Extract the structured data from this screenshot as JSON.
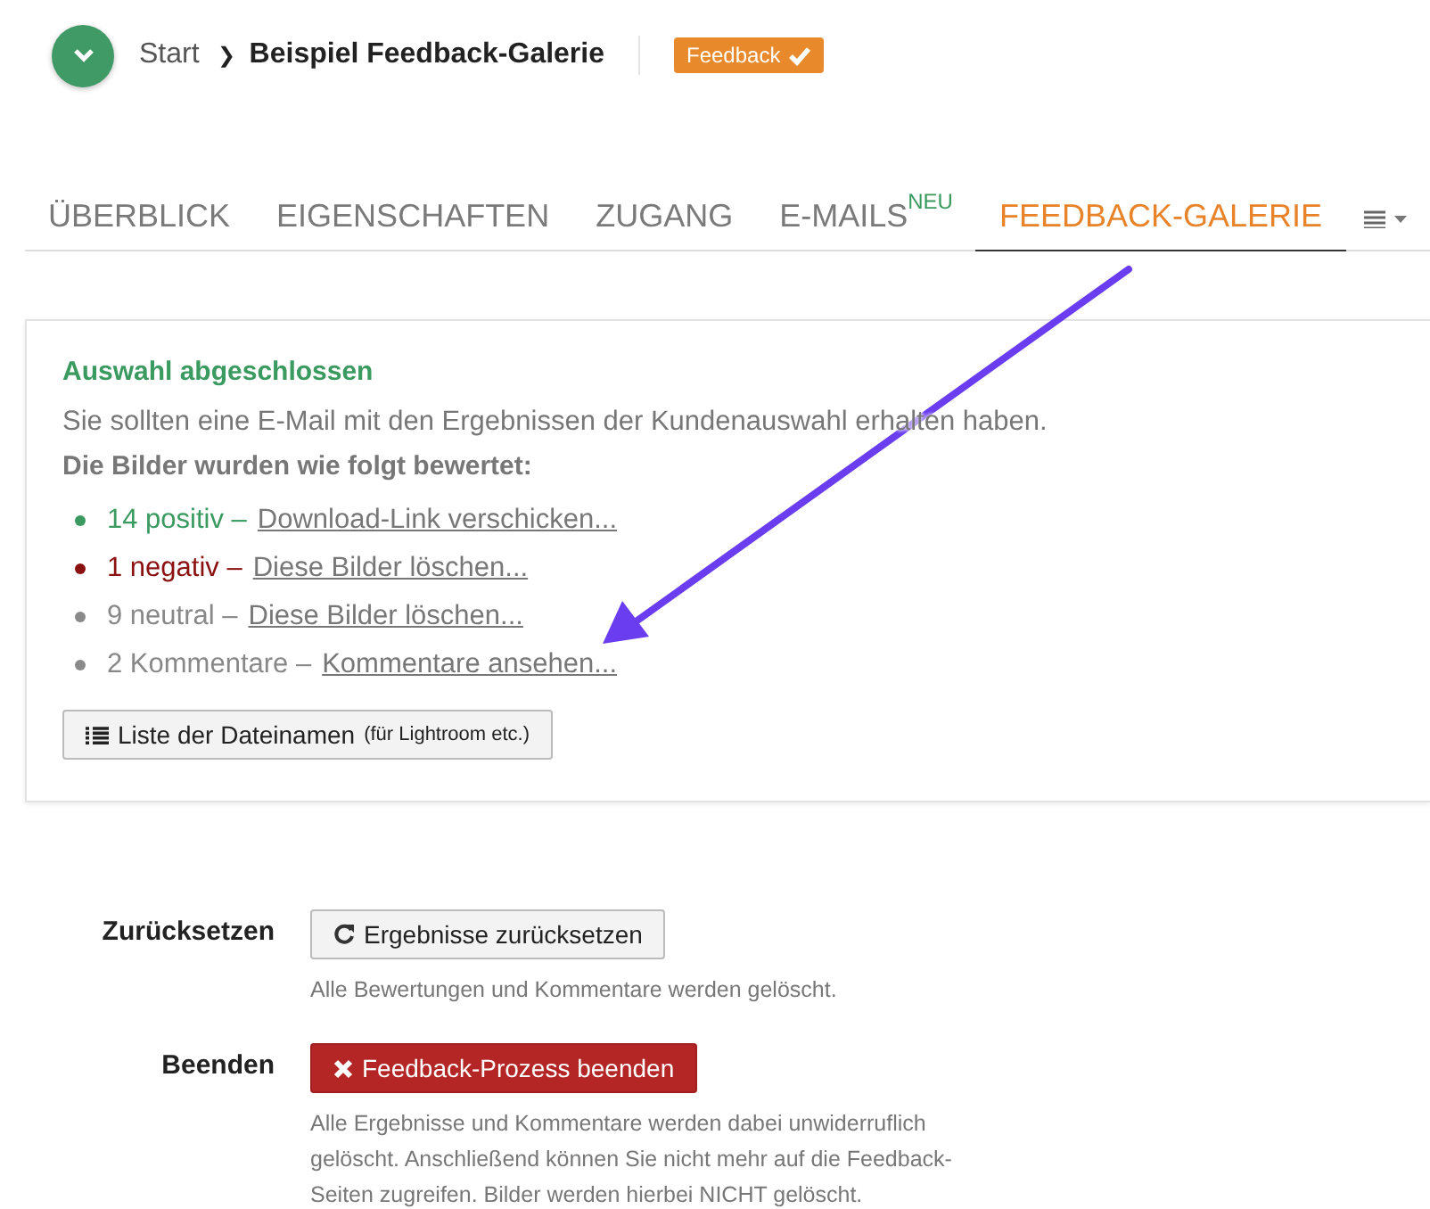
{
  "breadcrumb": {
    "root": "Start",
    "separator": "❯",
    "current": "Beispiel Feedback-Galerie"
  },
  "status_badge": {
    "label": "Feedback",
    "checked": true
  },
  "tabs": [
    {
      "label": "ÜBERBLICK",
      "selected": false
    },
    {
      "label": "EIGENSCHAFTEN",
      "selected": false
    },
    {
      "label": "ZUGANG",
      "selected": false
    },
    {
      "label": "E-MAILS",
      "badge": "NEU",
      "selected": false
    },
    {
      "label": "FEEDBACK-GALERIE",
      "selected": true
    }
  ],
  "result_panel": {
    "title": "Auswahl abgeschlossen",
    "message": "Sie sollten eine E-Mail mit den Ergebnissen der Kundenauswahl erhalten haben.",
    "subtitle": "Die Bilder wurden wie folgt bewertet:",
    "ratings": [
      {
        "count": "14 positiv –",
        "link": "Download-Link verschicken...",
        "color": "#3a9a5f"
      },
      {
        "count": "1 negativ –",
        "link": "Diese Bilder löschen...",
        "color": "#8b1010"
      },
      {
        "count": "9 neutral –",
        "link": "Diese Bilder löschen...",
        "color": "#8a8a8a"
      },
      {
        "count": "2 Kommentare –",
        "link": "Kommentare ansehen...",
        "color": "#8a8a8a"
      }
    ],
    "list_button": {
      "label": "Liste der Dateinamen",
      "note": "(für Lightroom etc.)"
    }
  },
  "actions": [
    {
      "label": "Zurücksetzen",
      "button": "Ergebnisse zurücksetzen",
      "kind": "reset",
      "description": "Alle Bewertungen und Kommentare werden gelöscht."
    },
    {
      "label": "Beenden",
      "button": "Feedback-Prozess beenden",
      "kind": "danger",
      "description": "Alle Ergebnisse und Kommentare werden dabei unwiderruflich gelöscht. Anschließend können Sie nicht mehr auf die Feedback-Seiten zugreifen. Bilder werden hierbei NICHT gelöscht."
    }
  ]
}
